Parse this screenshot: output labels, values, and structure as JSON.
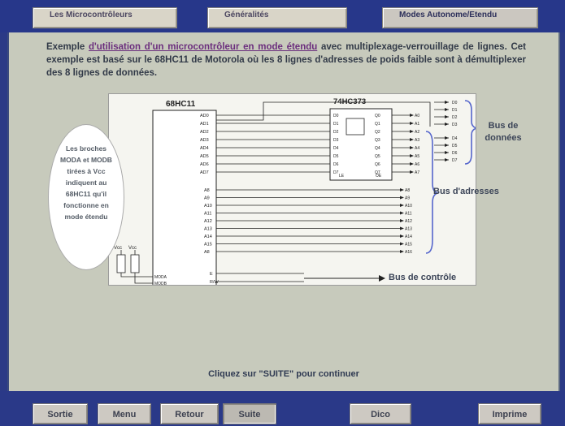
{
  "tabs": [
    {
      "label": "Les Microcontrôleurs"
    },
    {
      "label": "Généralités"
    },
    {
      "label": "Modes Autonome/Etendu"
    }
  ],
  "intro": {
    "w_exemple": "Exemple",
    "w_utilisation": "d'utilisation d'un microcontrôleur en mode étendu",
    "w_avec": "avec multiplexage-verrouillage de lignes. Cet exemple est basé sur le 68HC11 de Motorola où les 8 lignes d'adresses de poids faible sont à démultiplexer des 8 lignes de données."
  },
  "diagram": {
    "chip1_name": "68HC11",
    "chip2_name": "74HC373",
    "bubble_text": "Les broches MODA et MODB tirées à Vcc indiquent au 68HC11 qu'il fonctionne en mode étendu",
    "bus_donnees": "Bus de données",
    "bus_adresses": "Bus d'adresses",
    "bus_controle": "Bus de contrôle",
    "chip1_pins_low": [
      "AD0",
      "AD1",
      "AD2",
      "AD3",
      "AD4",
      "AD5",
      "AD6",
      "AD7"
    ],
    "chip1_pins_high": [
      "A8",
      "A9",
      "A10",
      "A11",
      "A12",
      "A13",
      "A14",
      "A15",
      "A8"
    ],
    "chip1_ctrl": [
      "E",
      "R/W"
    ],
    "chip1_mode": [
      "MODA",
      "MODB"
    ],
    "latch_in": [
      "D0",
      "D1",
      "D2",
      "D3",
      "D4",
      "D5",
      "D6",
      "D7"
    ],
    "latch_out": [
      "Q0",
      "Q1",
      "Q2",
      "Q3",
      "Q4",
      "Q5",
      "Q6",
      "Q7"
    ],
    "addr_low_out": [
      "A0",
      "A1",
      "A2",
      "A3",
      "A4",
      "A5",
      "A6",
      "A7"
    ],
    "addr_high_out": [
      "A8",
      "A9",
      "A10",
      "A11",
      "A12",
      "A13",
      "A14",
      "A15",
      "A16"
    ],
    "data_pins": [
      "D0",
      "D1",
      "D2",
      "D3",
      "D4",
      "D5",
      "D6",
      "D7"
    ],
    "vcc": "Vcc",
    "latch_oe": "OE",
    "latch_le": "LE"
  },
  "footer_text": "Cliquez sur \"SUITE\" pour continuer",
  "buttons": {
    "sortie": "Sortie",
    "menu": "Menu",
    "retour": "Retour",
    "suite": "Suite",
    "dico": "Dico",
    "imprime": "Imprime"
  },
  "colors": {
    "frame_blue": "#2b3a86",
    "panel_bg": "#c7cabc",
    "diagram_bg": "#f5f5f0",
    "text_dark": "#323a48",
    "underline_purple": "#6b2e7d"
  }
}
